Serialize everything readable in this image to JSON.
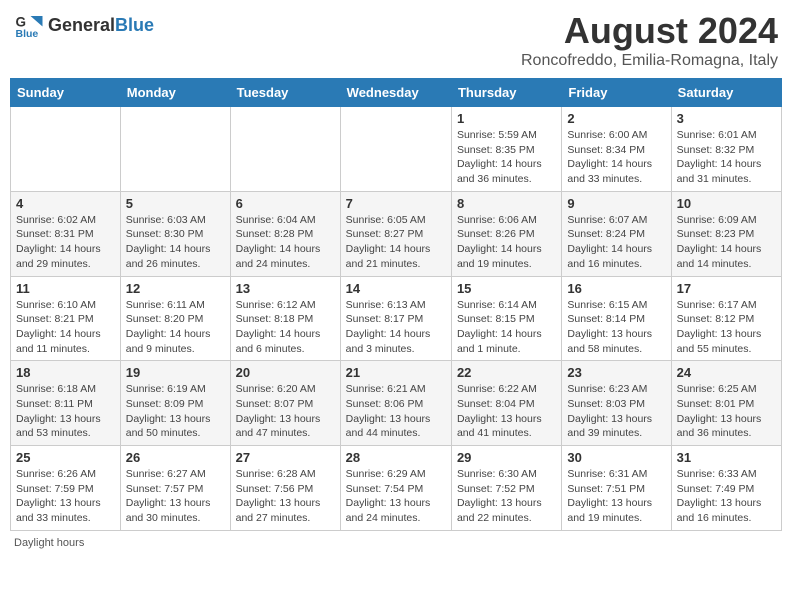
{
  "header": {
    "logo_general": "General",
    "logo_blue": "Blue",
    "title": "August 2024",
    "subtitle": "Roncofreddo, Emilia-Romagna, Italy"
  },
  "days_of_week": [
    "Sunday",
    "Monday",
    "Tuesday",
    "Wednesday",
    "Thursday",
    "Friday",
    "Saturday"
  ],
  "weeks": [
    [
      {
        "day": "",
        "info": ""
      },
      {
        "day": "",
        "info": ""
      },
      {
        "day": "",
        "info": ""
      },
      {
        "day": "",
        "info": ""
      },
      {
        "day": "1",
        "info": "Sunrise: 5:59 AM\nSunset: 8:35 PM\nDaylight: 14 hours\nand 36 minutes."
      },
      {
        "day": "2",
        "info": "Sunrise: 6:00 AM\nSunset: 8:34 PM\nDaylight: 14 hours\nand 33 minutes."
      },
      {
        "day": "3",
        "info": "Sunrise: 6:01 AM\nSunset: 8:32 PM\nDaylight: 14 hours\nand 31 minutes."
      }
    ],
    [
      {
        "day": "4",
        "info": "Sunrise: 6:02 AM\nSunset: 8:31 PM\nDaylight: 14 hours\nand 29 minutes."
      },
      {
        "day": "5",
        "info": "Sunrise: 6:03 AM\nSunset: 8:30 PM\nDaylight: 14 hours\nand 26 minutes."
      },
      {
        "day": "6",
        "info": "Sunrise: 6:04 AM\nSunset: 8:28 PM\nDaylight: 14 hours\nand 24 minutes."
      },
      {
        "day": "7",
        "info": "Sunrise: 6:05 AM\nSunset: 8:27 PM\nDaylight: 14 hours\nand 21 minutes."
      },
      {
        "day": "8",
        "info": "Sunrise: 6:06 AM\nSunset: 8:26 PM\nDaylight: 14 hours\nand 19 minutes."
      },
      {
        "day": "9",
        "info": "Sunrise: 6:07 AM\nSunset: 8:24 PM\nDaylight: 14 hours\nand 16 minutes."
      },
      {
        "day": "10",
        "info": "Sunrise: 6:09 AM\nSunset: 8:23 PM\nDaylight: 14 hours\nand 14 minutes."
      }
    ],
    [
      {
        "day": "11",
        "info": "Sunrise: 6:10 AM\nSunset: 8:21 PM\nDaylight: 14 hours\nand 11 minutes."
      },
      {
        "day": "12",
        "info": "Sunrise: 6:11 AM\nSunset: 8:20 PM\nDaylight: 14 hours\nand 9 minutes."
      },
      {
        "day": "13",
        "info": "Sunrise: 6:12 AM\nSunset: 8:18 PM\nDaylight: 14 hours\nand 6 minutes."
      },
      {
        "day": "14",
        "info": "Sunrise: 6:13 AM\nSunset: 8:17 PM\nDaylight: 14 hours\nand 3 minutes."
      },
      {
        "day": "15",
        "info": "Sunrise: 6:14 AM\nSunset: 8:15 PM\nDaylight: 14 hours\nand 1 minute."
      },
      {
        "day": "16",
        "info": "Sunrise: 6:15 AM\nSunset: 8:14 PM\nDaylight: 13 hours\nand 58 minutes."
      },
      {
        "day": "17",
        "info": "Sunrise: 6:17 AM\nSunset: 8:12 PM\nDaylight: 13 hours\nand 55 minutes."
      }
    ],
    [
      {
        "day": "18",
        "info": "Sunrise: 6:18 AM\nSunset: 8:11 PM\nDaylight: 13 hours\nand 53 minutes."
      },
      {
        "day": "19",
        "info": "Sunrise: 6:19 AM\nSunset: 8:09 PM\nDaylight: 13 hours\nand 50 minutes."
      },
      {
        "day": "20",
        "info": "Sunrise: 6:20 AM\nSunset: 8:07 PM\nDaylight: 13 hours\nand 47 minutes."
      },
      {
        "day": "21",
        "info": "Sunrise: 6:21 AM\nSunset: 8:06 PM\nDaylight: 13 hours\nand 44 minutes."
      },
      {
        "day": "22",
        "info": "Sunrise: 6:22 AM\nSunset: 8:04 PM\nDaylight: 13 hours\nand 41 minutes."
      },
      {
        "day": "23",
        "info": "Sunrise: 6:23 AM\nSunset: 8:03 PM\nDaylight: 13 hours\nand 39 minutes."
      },
      {
        "day": "24",
        "info": "Sunrise: 6:25 AM\nSunset: 8:01 PM\nDaylight: 13 hours\nand 36 minutes."
      }
    ],
    [
      {
        "day": "25",
        "info": "Sunrise: 6:26 AM\nSunset: 7:59 PM\nDaylight: 13 hours\nand 33 minutes."
      },
      {
        "day": "26",
        "info": "Sunrise: 6:27 AM\nSunset: 7:57 PM\nDaylight: 13 hours\nand 30 minutes."
      },
      {
        "day": "27",
        "info": "Sunrise: 6:28 AM\nSunset: 7:56 PM\nDaylight: 13 hours\nand 27 minutes."
      },
      {
        "day": "28",
        "info": "Sunrise: 6:29 AM\nSunset: 7:54 PM\nDaylight: 13 hours\nand 24 minutes."
      },
      {
        "day": "29",
        "info": "Sunrise: 6:30 AM\nSunset: 7:52 PM\nDaylight: 13 hours\nand 22 minutes."
      },
      {
        "day": "30",
        "info": "Sunrise: 6:31 AM\nSunset: 7:51 PM\nDaylight: 13 hours\nand 19 minutes."
      },
      {
        "day": "31",
        "info": "Sunrise: 6:33 AM\nSunset: 7:49 PM\nDaylight: 13 hours\nand 16 minutes."
      }
    ]
  ],
  "footer": "Daylight hours"
}
